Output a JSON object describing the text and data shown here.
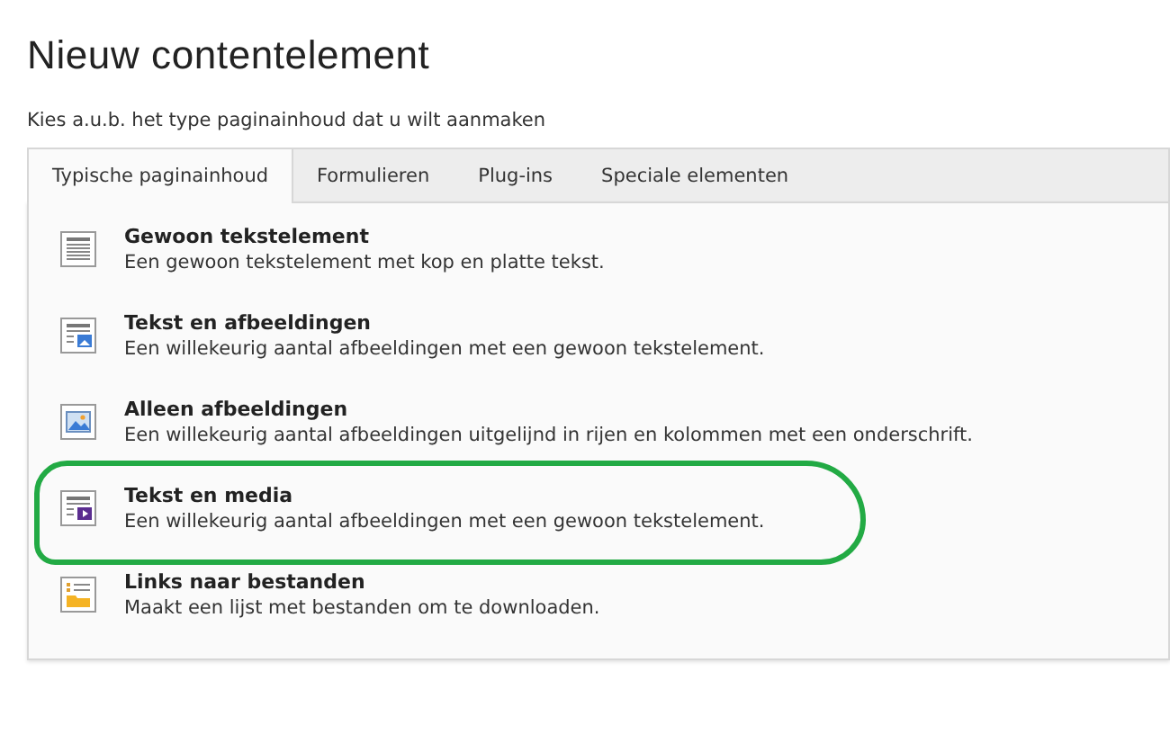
{
  "title": "Nieuw contentelement",
  "subtitle": "Kies a.u.b. het type paginainhoud dat u wilt aanmaken",
  "tabs": [
    {
      "label": "Typische paginainhoud",
      "selected": true
    },
    {
      "label": "Formulieren",
      "selected": false
    },
    {
      "label": "Plug-ins",
      "selected": false
    },
    {
      "label": "Speciale elementen",
      "selected": false
    }
  ],
  "items": [
    {
      "kind": "text",
      "title": "Gewoon tekstelement",
      "description": "Een gewoon tekstelement met kop en platte tekst.",
      "highlighted": false
    },
    {
      "kind": "text-image",
      "title": "Tekst en afbeeldingen",
      "description": "Een willekeurig aantal afbeeldingen met een gewoon tekstelement.",
      "highlighted": false
    },
    {
      "kind": "image",
      "title": "Alleen afbeeldingen",
      "description": "Een willekeurig aantal afbeeldingen uitgelijnd in rijen en kolommen met een onderschrift.",
      "highlighted": false
    },
    {
      "kind": "text-media",
      "title": "Tekst en media",
      "description": "Een willekeurig aantal afbeeldingen met een gewoon tekstelement.",
      "highlighted": true
    },
    {
      "kind": "files",
      "title": "Links naar bestanden",
      "description": "Maakt een lijst met bestanden om te downloaden.",
      "highlighted": false
    }
  ]
}
